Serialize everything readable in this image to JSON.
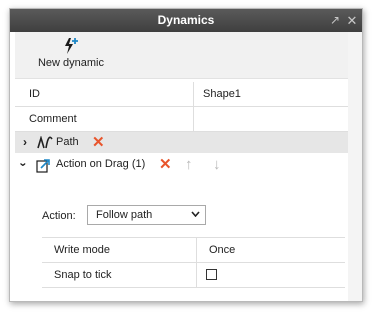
{
  "window": {
    "title": "Dynamics",
    "pin_glyph": "↗",
    "close_glyph": "✕"
  },
  "toolbar": {
    "new_dynamic_label": "New dynamic",
    "new_dynamic_icon": "lightning-plus-icon"
  },
  "properties": [
    {
      "key": "ID",
      "value": "Shape1"
    },
    {
      "key": "Comment",
      "value": ""
    }
  ],
  "path_row": {
    "label": "Path",
    "icon": "path-wave-icon"
  },
  "drag_row": {
    "label": "Action on Drag (1)",
    "icon": "drag-arrow-icon"
  },
  "action": {
    "label": "Action:",
    "selected": "Follow path"
  },
  "settings": [
    {
      "key": "Write mode",
      "value": "Once"
    },
    {
      "key": "Snap to tick",
      "checked": false
    }
  ],
  "colors": {
    "title_bar": "#4a4a4a",
    "delete_red": "#e8552c",
    "disabled_arrow": "#b8b8b8",
    "accent_blue": "#1e88c7"
  }
}
